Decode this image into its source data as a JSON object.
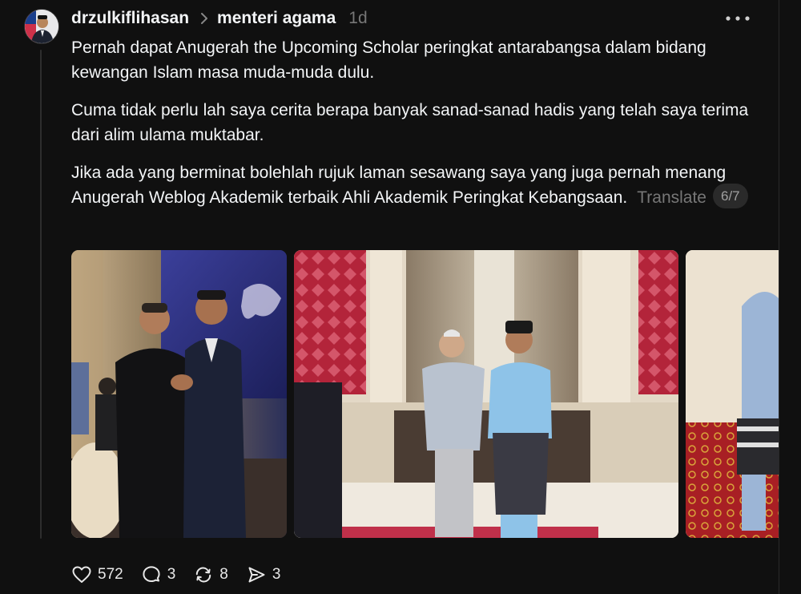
{
  "post": {
    "username": "drzulkiflihasan",
    "topic": "menteri agama",
    "time": "1d",
    "paragraphs": [
      "Pernah dapat Anugerah the Upcoming Scholar peringkat antarabangsa dalam bidang kewangan Islam masa muda-muda dulu.",
      "Cuma tidak perlu lah saya cerita berapa banyak sanad-sanad hadis yang telah saya terima dari alim ulama muktabar.",
      "Jika ada yang berminat bolehlah rujuk laman sesawang saya yang juga pernah menang Anugerah Weblog Akademik terbaik Ahli Akademik Peringkat Kebangsaan."
    ],
    "translate_label": "Translate",
    "pager": "6/7"
  },
  "actions": {
    "likes": "572",
    "replies": "3",
    "reposts": "8",
    "shares": "3"
  },
  "icons": {
    "like": "heart-icon",
    "reply": "comment-icon",
    "repost": "repost-icon",
    "share": "send-icon",
    "more": "more-dots-icon",
    "chevron": "chevron-right-icon"
  },
  "colors": {
    "background": "#101010",
    "text": "#f3f5f7",
    "muted": "#777777"
  }
}
